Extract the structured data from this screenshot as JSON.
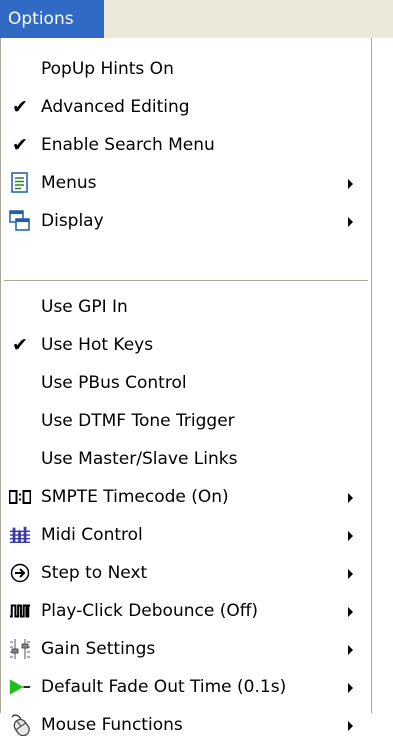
{
  "menu": {
    "title": "Options",
    "items": [
      {
        "label": "PopUp Hints On"
      },
      {
        "label": "Advanced Editing",
        "checked": true
      },
      {
        "label": "Enable Search Menu",
        "checked": true
      },
      {
        "label": "Menus",
        "icon": "document-list-icon",
        "submenu": true
      },
      {
        "label": "Display",
        "icon": "windows-icon",
        "submenu": true
      },
      {
        "label": "Use GPI In"
      },
      {
        "label": "Use Hot Keys",
        "checked": true
      },
      {
        "label": "Use PBus Control"
      },
      {
        "label": "Use DTMF Tone Trigger"
      },
      {
        "label": "Use Master/Slave Links"
      },
      {
        "label": "SMPTE Timecode (On)",
        "icon": "timecode-icon",
        "submenu": true
      },
      {
        "label": "Midi Control",
        "icon": "midi-keyboard-icon",
        "submenu": true
      },
      {
        "label": "Step to Next",
        "icon": "step-next-icon",
        "submenu": true
      },
      {
        "label": "Play-Click Debounce (Off)",
        "icon": "pulse-wave-icon",
        "submenu": true
      },
      {
        "label": "Gain Settings",
        "icon": "fader-icon",
        "submenu": true
      },
      {
        "label": "Default Fade Out Time (0.1s)",
        "icon": "fade-ramp-icon",
        "submenu": true
      },
      {
        "label": "Mouse Functions",
        "icon": "mouse-icon",
        "submenu": true
      }
    ]
  },
  "colors": {
    "highlight": "#316ac5",
    "menubar": "#ece9d8",
    "border": "#aca899",
    "fade_green": "#1ec01e"
  }
}
